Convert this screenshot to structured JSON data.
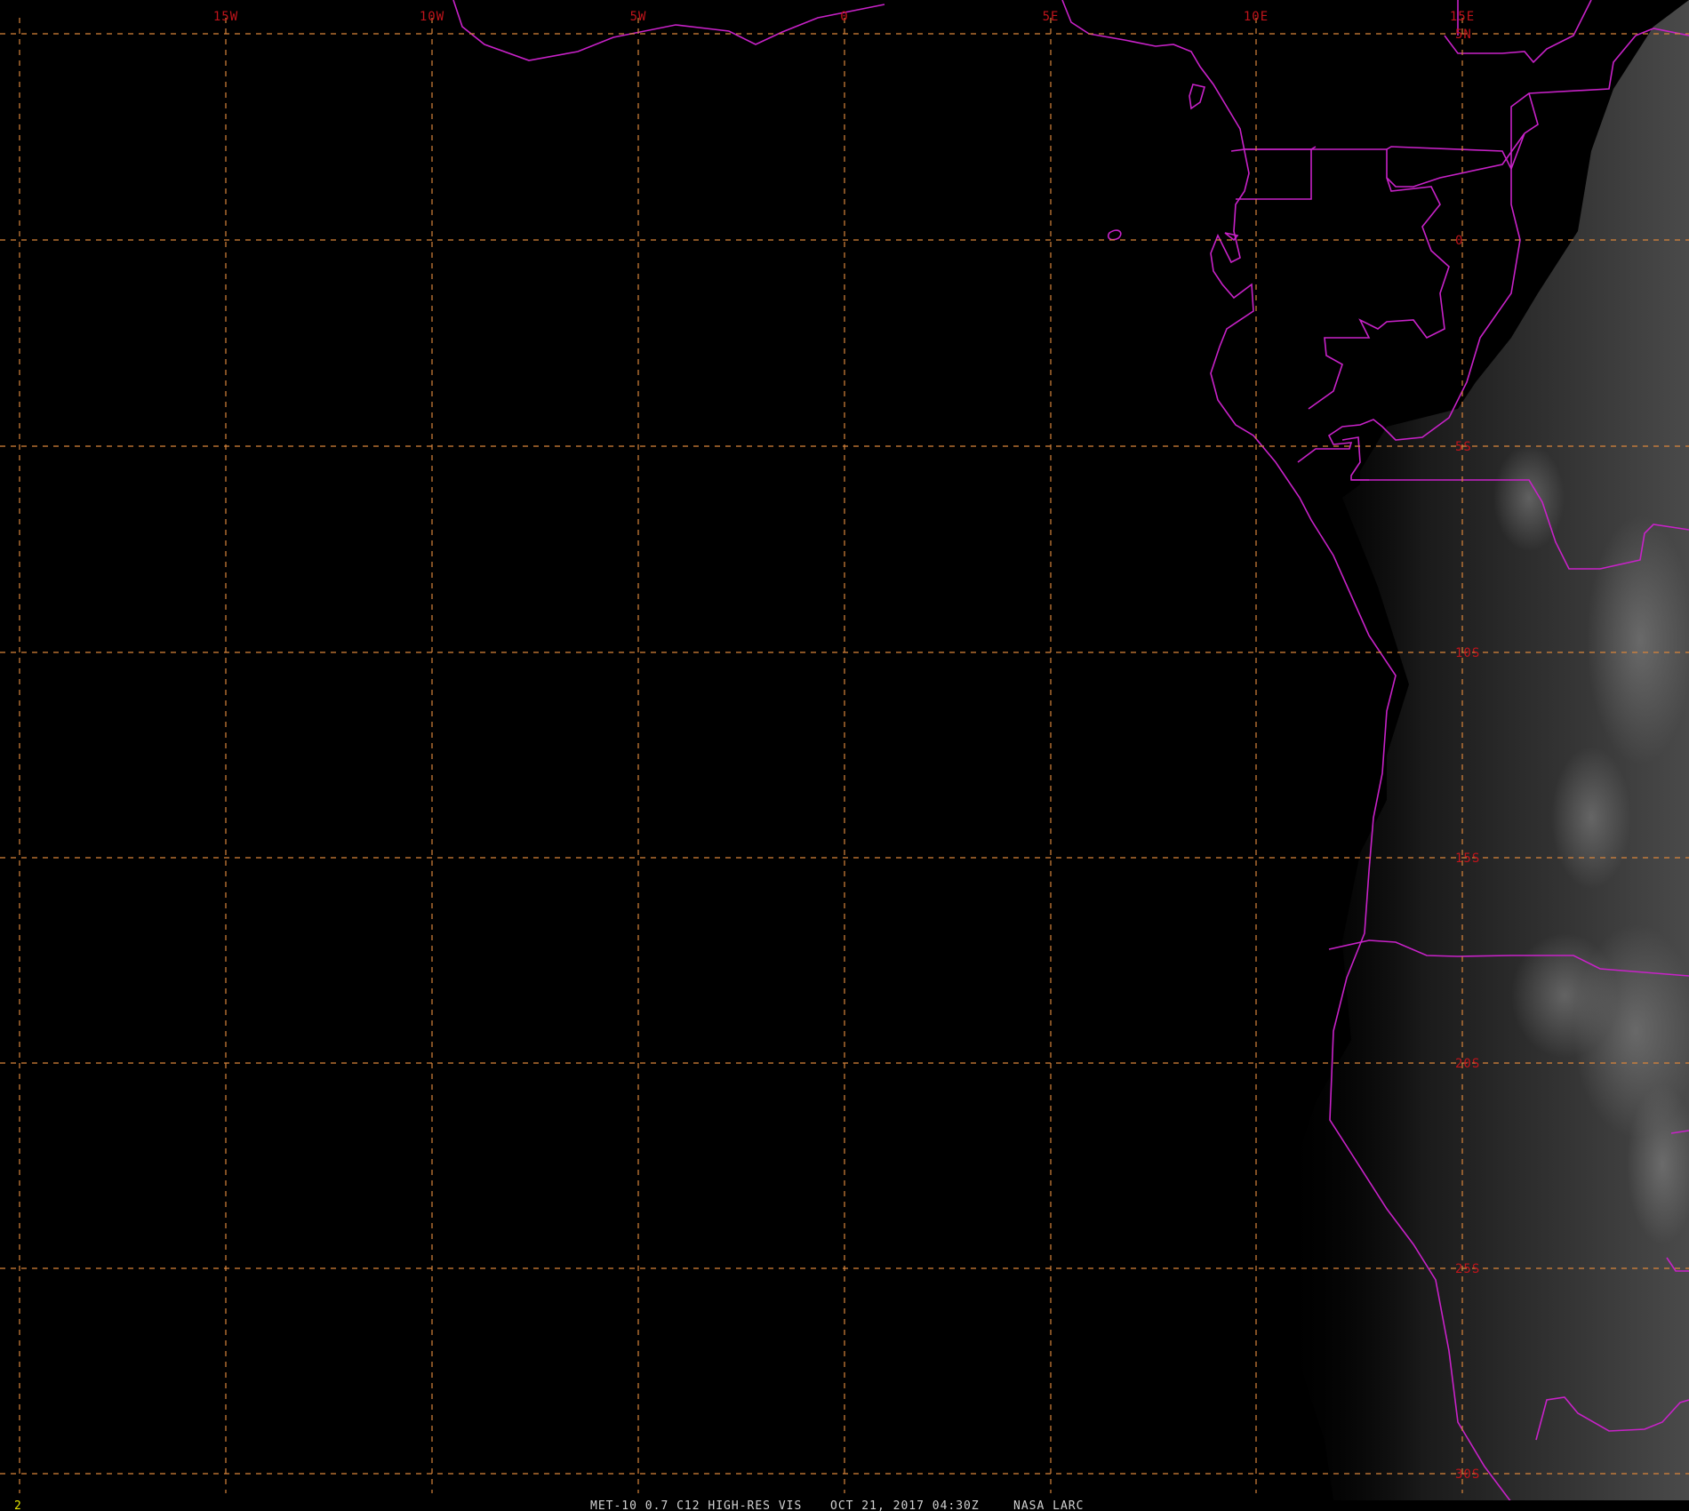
{
  "image": {
    "kind": "satellite-visible-image",
    "colors": {
      "background": "#000000",
      "grid": "#d9853b",
      "label": "#c0141b",
      "border": "#c822c8",
      "frame_number": "#e6e600",
      "caption": "#d0d0d0",
      "land_lit": "#3e3e3e"
    }
  },
  "lon_labels": [
    "15W",
    "10W",
    "5W",
    "0",
    "5E",
    "10E",
    "15E"
  ],
  "lat_labels": [
    "5N",
    "0",
    "5S",
    "10S",
    "15S",
    "20S",
    "25S",
    "30S"
  ],
  "frame_number": "2",
  "caption": {
    "product": "MET-10 0.7 C12 HIGH-RES VIS",
    "datetime": "OCT 21, 2017 04:30Z",
    "source": "NASA LARC"
  }
}
